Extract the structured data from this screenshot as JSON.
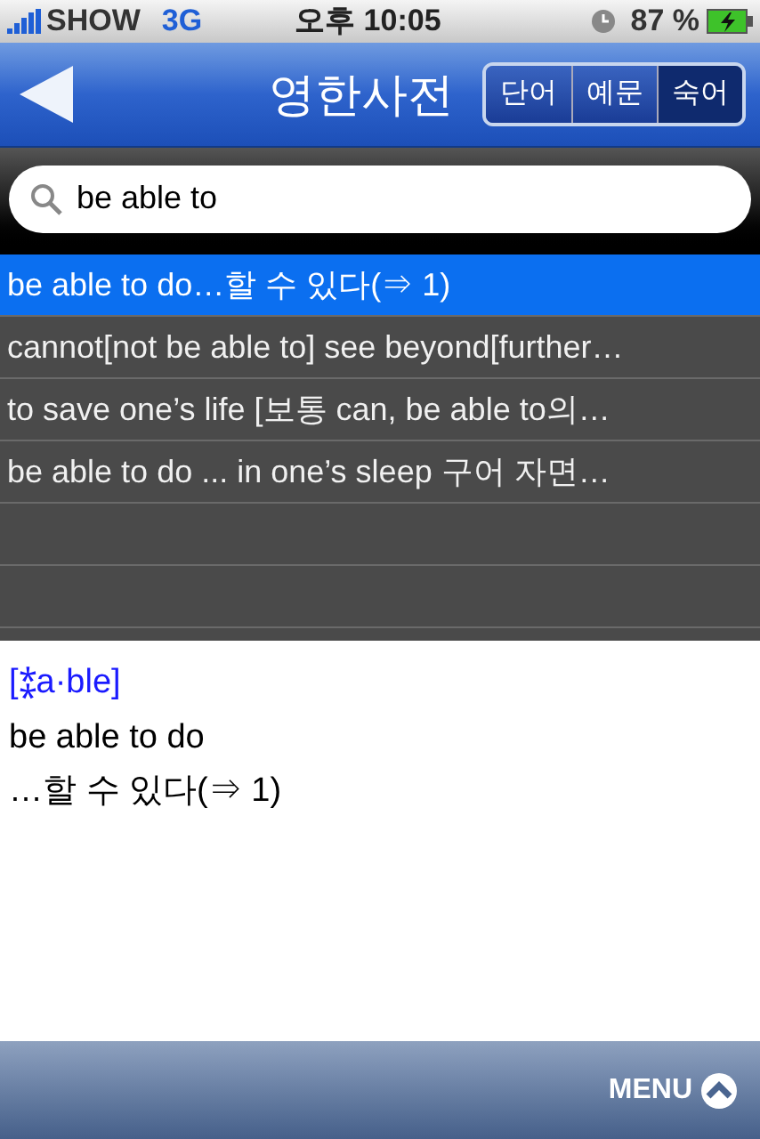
{
  "status_bar": {
    "carrier": "SHOW",
    "network": "3G",
    "time": "오후 10:05",
    "battery": "87 %"
  },
  "nav_bar": {
    "title": "영한사전",
    "segments": [
      {
        "label": "단어",
        "selected": false
      },
      {
        "label": "예문",
        "selected": false
      },
      {
        "label": "숙어",
        "selected": true
      }
    ]
  },
  "search": {
    "value": "be able to"
  },
  "results": [
    {
      "text": "be able to do…할 수 있다(⇒ 1)",
      "selected": true
    },
    {
      "text": "cannot[not be able to] see beyond[further…",
      "selected": false
    },
    {
      "text": "to save one’s life [보통 can, be able to의…",
      "selected": false
    },
    {
      "text": "be able to do ... in one’s sleep 구어 자면…",
      "selected": false
    }
  ],
  "entry": {
    "headword": "[⁑a·ble]",
    "phrase": "be able to do",
    "meaning": "…할 수 있다(⇒ 1)"
  },
  "toolbar": {
    "menu": "MENU"
  }
}
